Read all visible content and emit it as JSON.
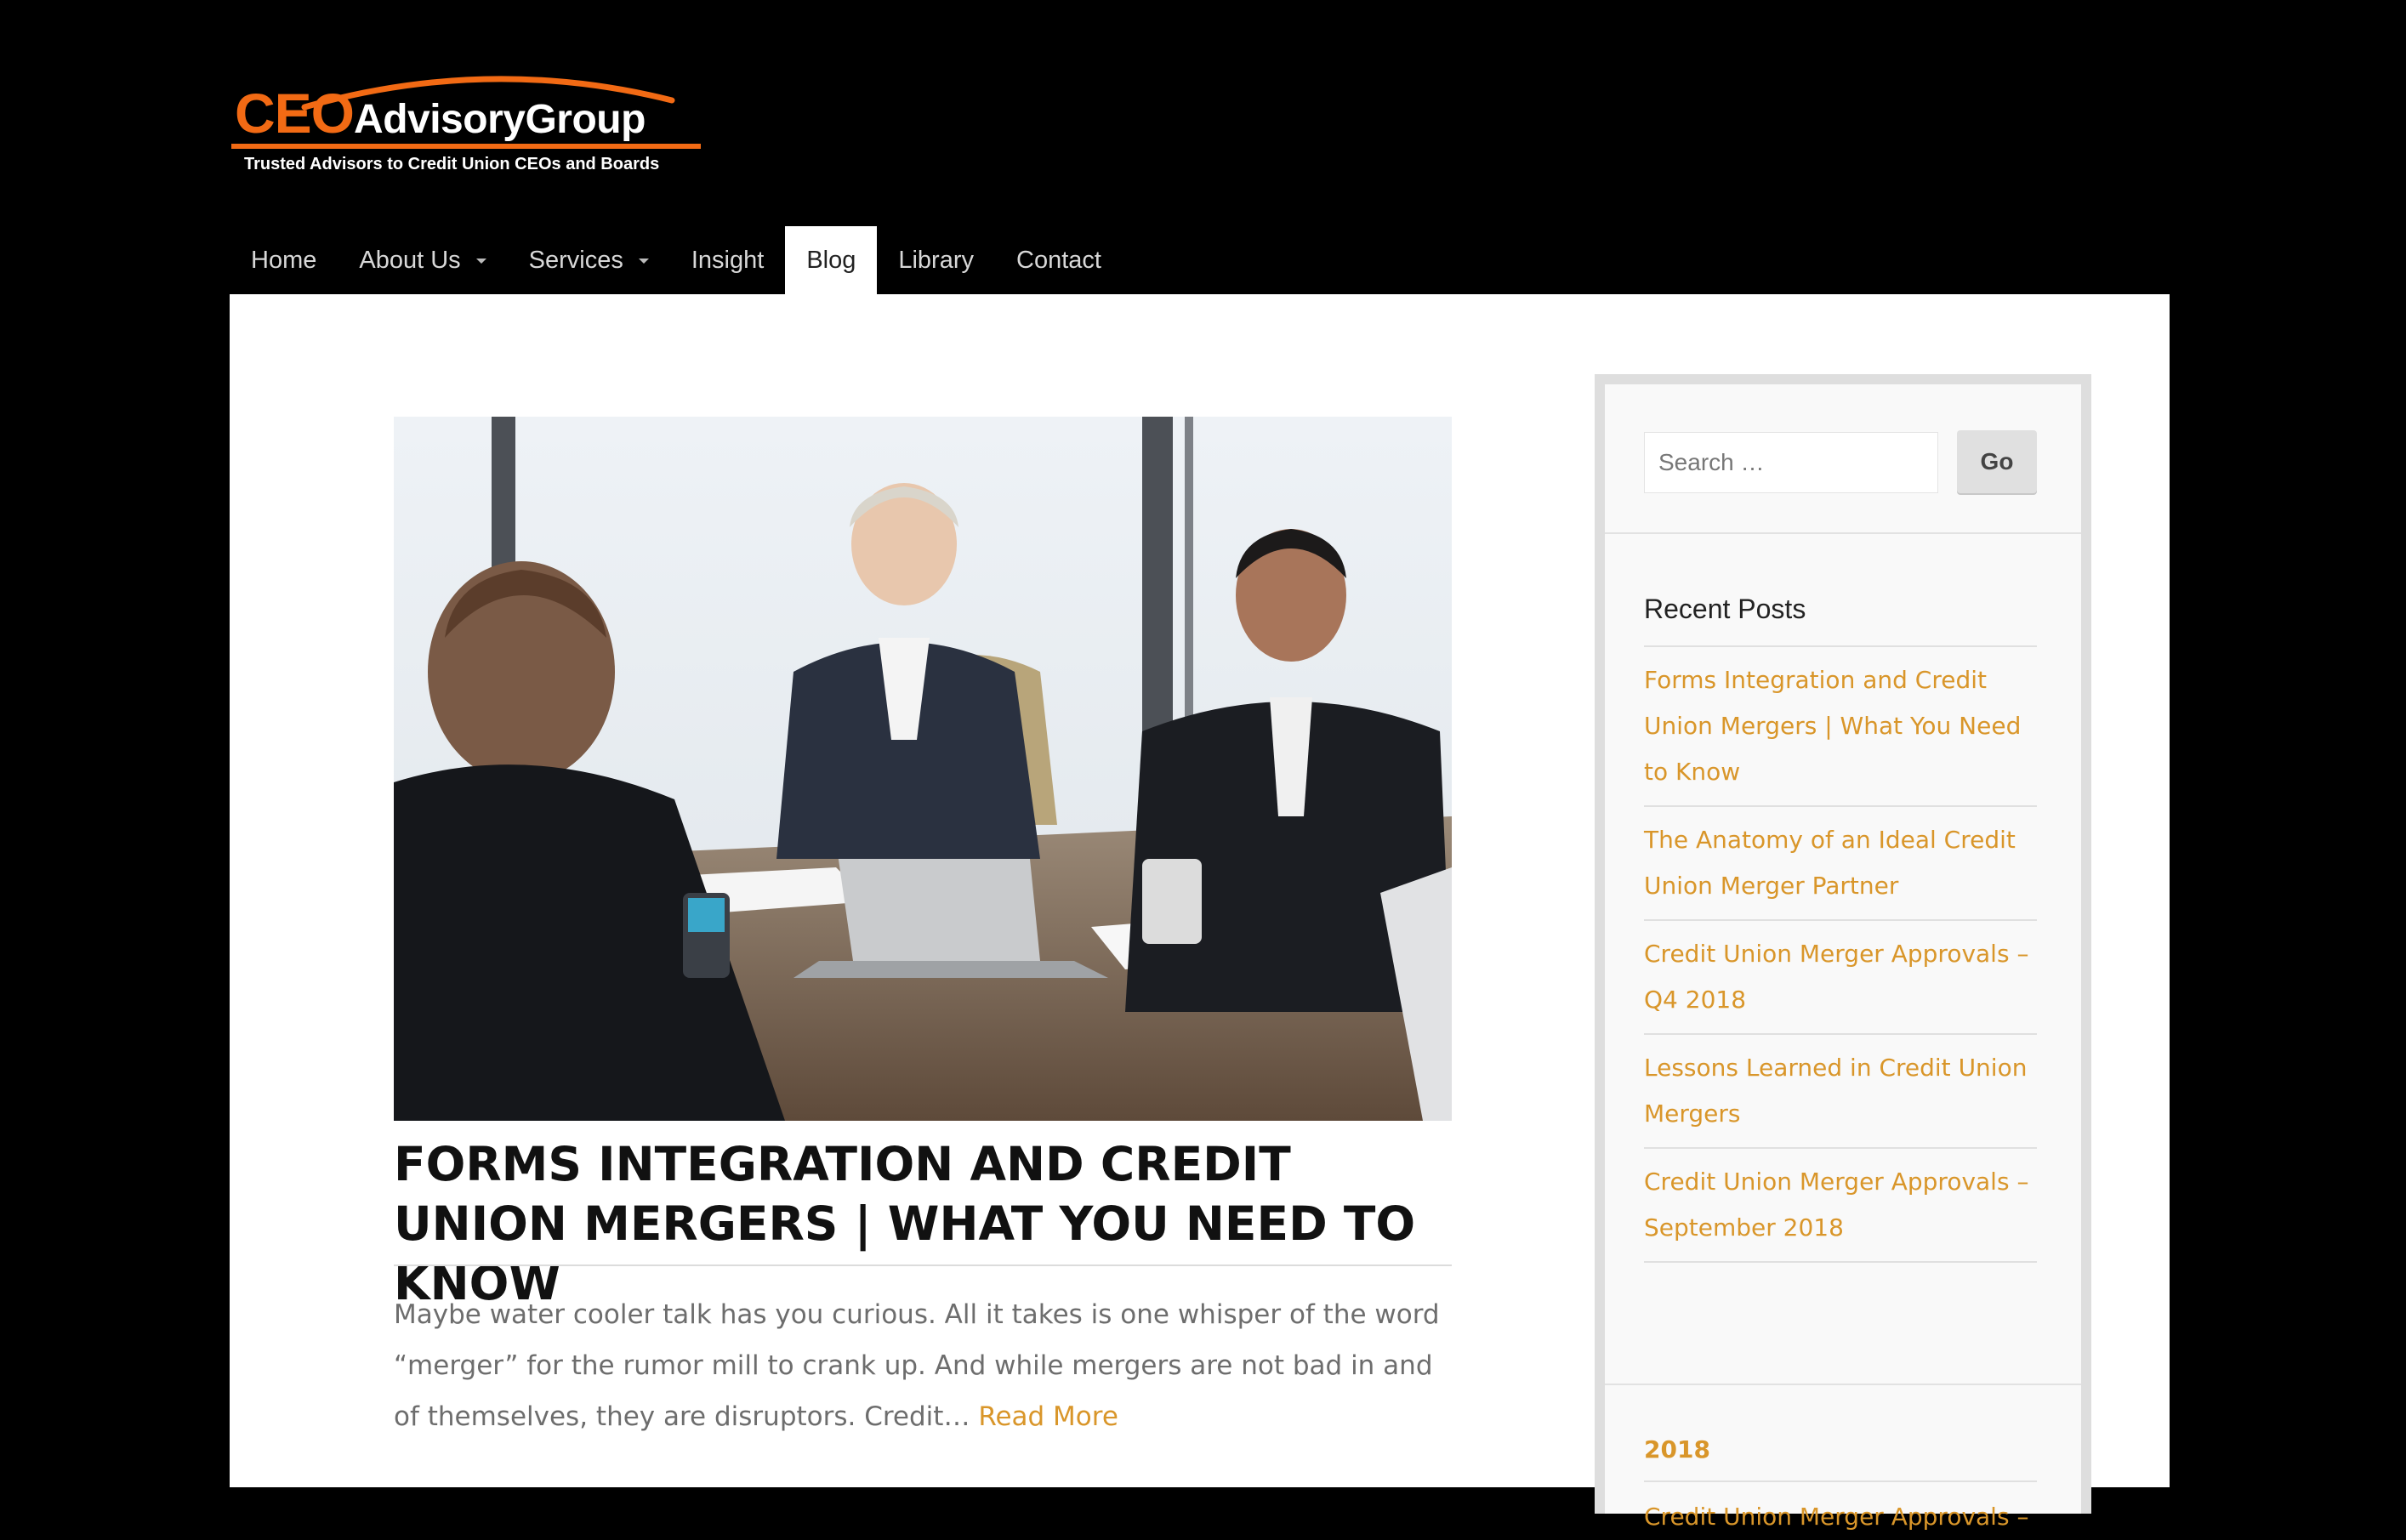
{
  "logo": {
    "ceo_text": "CEO",
    "rest_text": "AdvisoryGroup",
    "tagline": "Trusted Advisors to Credit Union CEOs and Boards",
    "colors": {
      "accent": "#f26a14",
      "text": "#ffffff"
    }
  },
  "nav": {
    "items": [
      {
        "label": "Home"
      },
      {
        "label": "About Us"
      },
      {
        "label": "Services"
      },
      {
        "label": "Insight"
      },
      {
        "label": "Blog"
      },
      {
        "label": "Library"
      },
      {
        "label": "Contact"
      }
    ],
    "active": "Blog"
  },
  "post": {
    "title": "Forms Integration and Credit Union Mergers | What You Need to Know",
    "excerpt": "Maybe water cooler talk has you curious. All it takes is one whisper of the word “merger” for the rumor mill to crank up. And while mergers are not bad in and of themselves, they are disruptors. Credit…",
    "read_more": "Read More"
  },
  "sidebar": {
    "search": {
      "placeholder": "Search …",
      "button_label": "Go"
    },
    "recent_posts": {
      "title": "Recent Posts",
      "items": [
        {
          "label": "Forms Integration and Credit Union Mergers | What You Need to Know"
        },
        {
          "label": "The Anatomy of an Ideal Credit Union Merger Partner"
        },
        {
          "label": "Credit Union Merger Approvals – Q4 2018"
        },
        {
          "label": "Lessons Learned in Credit Union Mergers"
        },
        {
          "label": "Credit Union Merger Approvals – September 2018"
        }
      ]
    },
    "archive": {
      "year": "2018",
      "first_item": "Credit Union Merger Approvals –"
    }
  },
  "colors": {
    "page_background": "#000000",
    "content_background": "#ffffff",
    "link": "#d9962a",
    "sidebar_background": "#f9f9f9",
    "sidebar_border": "#dedede"
  }
}
